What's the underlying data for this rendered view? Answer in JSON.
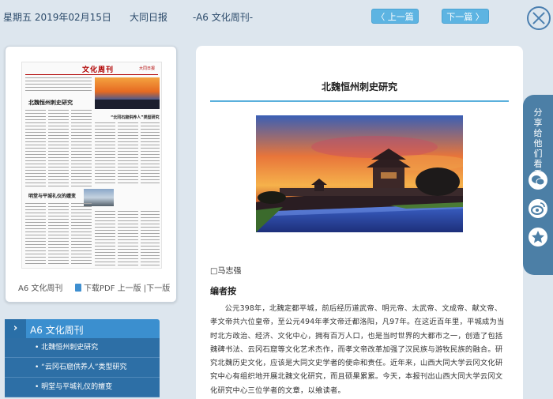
{
  "header": {
    "date": "星期五 2019年02月15日",
    "paper_name": "大同日报",
    "page_label": "-A6 文化周刊-",
    "prev_label": "〈 上一篇",
    "next_label": "下一篇 〉"
  },
  "thumbnail": {
    "banner": "文化周刊",
    "mini_logo": "大同日报",
    "headline_main": "北魏恒州刺史研究",
    "headline_side": "“云冈石窟供养人”类型研究",
    "headline_lower": "明堂与平城礼仪的嬗变",
    "caption": "A6 文化周刊",
    "pdf_link": "下载PDF",
    "prev_page": "上一版",
    "separator": "|",
    "next_page": "下一版"
  },
  "sidebar": {
    "section_title": "A6 文化周刊",
    "arrow_icon": "chevron-right-icon",
    "articles": [
      "北魏恒州刺史研究",
      "“云冈石窟供养人”类型研究",
      "明堂与平城礼仪的嬗变"
    ]
  },
  "article": {
    "title": "北魏恒州刺史研究",
    "photo_icon": "datong-city-wall-photo",
    "author": "□马志强",
    "editor_note": "编者按",
    "body": "公元398年，北魏定都平城，前后经历道武帝、明元帝、太武帝、文成帝、献文帝、孝文帝共六位皇帝，至公元494年孝文帝迁都洛阳，凡97年。在这近百年里，平城成为当时北方政治、经济、文化中心，拥有百万人口，也是当时世界的大都市之一，创造了包括魏碑书法、云冈石窟等文化艺术杰作，而孝文帝改革加强了汉民族与游牧民族的融合。研究北魏历史文化，应该是大同文史学者的使命和责任。近年来，山西大同大学云冈文化研究中心有组织地开展北魏文化研究，而且硕果累累。今天，本报刊出山西大同大学云冈文化研究中心三位学者的文章，以飨读者。"
  },
  "share": {
    "label": "分享给他们看看",
    "wechat_icon": "wechat-icon",
    "weibo_icon": "weibo-icon",
    "favorite_icon": "star-icon"
  },
  "colors": {
    "accent": "#5db4e2",
    "section_blue": "#3b8fcf",
    "list_blue": "#2d6fa6",
    "share_blue": "#4c7fa6",
    "background": "#dde6ee"
  }
}
